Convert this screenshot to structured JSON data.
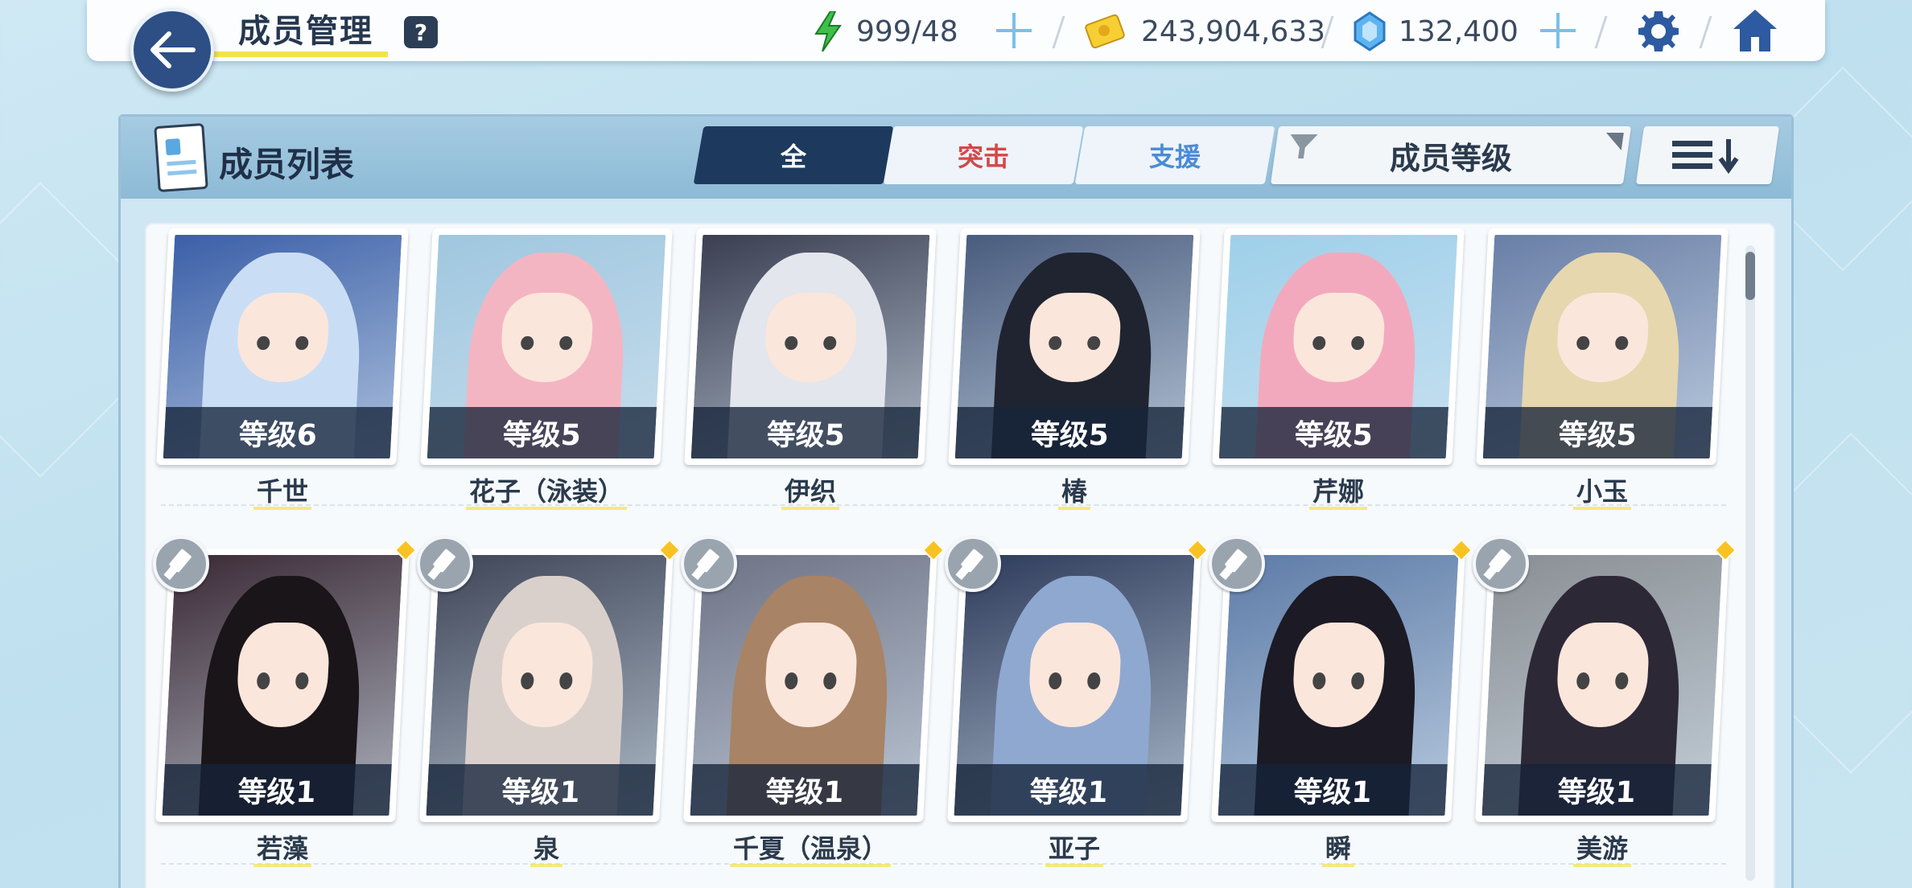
{
  "header": {
    "title": "成员管理",
    "help_label": "?",
    "ap": "999/48",
    "credits": "243,904,633",
    "gems": "132,400"
  },
  "panel": {
    "title": "成员列表",
    "tabs": [
      {
        "label": "全",
        "active": true
      },
      {
        "label": "突击",
        "color": "#d34848"
      },
      {
        "label": "支援",
        "color": "#4a8cd6"
      }
    ],
    "filter_label": "成员等级"
  },
  "rows": [
    [
      {
        "name": "千世",
        "level": "等级6",
        "bg": "#3b5fa8",
        "hair": "#c9def5"
      },
      {
        "name": "花子（泳装）",
        "level": "等级5",
        "bg": "#9fc7df",
        "hair": "#f4b5c3"
      },
      {
        "name": "伊织",
        "level": "等级5",
        "bg": "#3a3f52",
        "hair": "#e3e6ec"
      },
      {
        "name": "椿",
        "level": "等级5",
        "bg": "#4a5c7e",
        "hair": "#202430"
      },
      {
        "name": "芹娜",
        "level": "等级5",
        "bg": "#9ed0ea",
        "hair": "#f3a9bd"
      },
      {
        "name": "小玉",
        "level": "等级5",
        "bg": "#6a7fa7",
        "hair": "#e6d7ae"
      }
    ],
    [
      {
        "name": "若藻",
        "level": "等级1",
        "bg": "#3b2a36",
        "hair": "#1a1518"
      },
      {
        "name": "泉",
        "level": "等级1",
        "bg": "#3f4658",
        "hair": "#d9d0cc"
      },
      {
        "name": "千夏（温泉）",
        "level": "等级1",
        "bg": "#6e7386",
        "hair": "#a88366"
      },
      {
        "name": "亚子",
        "level": "等级1",
        "bg": "#2e3c5c",
        "hair": "#8fa8d0"
      },
      {
        "name": "瞬",
        "level": "等级1",
        "bg": "#5e7ca8",
        "hair": "#1c1a24"
      },
      {
        "name": "美游",
        "level": "等级1",
        "bg": "#8a8f94",
        "hair": "#2d2836"
      }
    ]
  ]
}
